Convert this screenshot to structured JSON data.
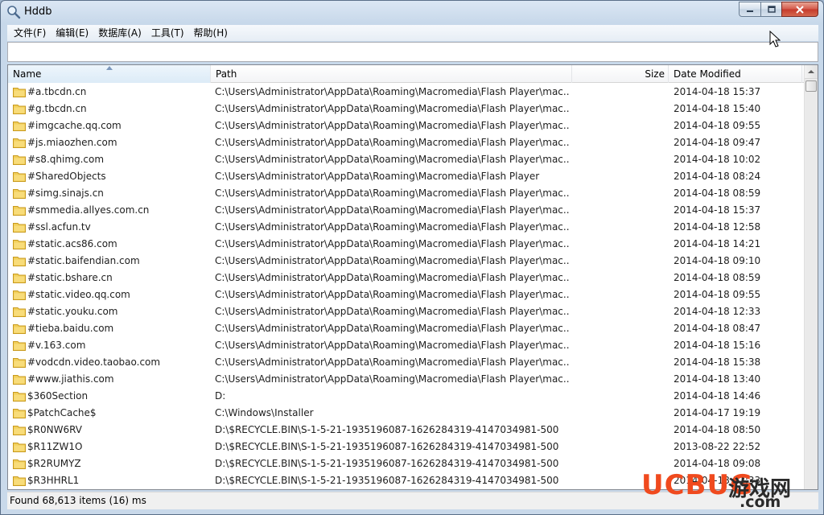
{
  "window": {
    "title": "Hddb"
  },
  "menu": [
    "文件(F)",
    "编辑(E)",
    "数据库(A)",
    "工具(T)",
    "帮助(H)"
  ],
  "search": {
    "value": "",
    "placeholder": ""
  },
  "columns": {
    "name": "Name",
    "path": "Path",
    "size": "Size",
    "date": "Date Modified"
  },
  "rows": [
    {
      "name": "#a.tbcdn.cn",
      "path": "C:\\Users\\Administrator\\AppData\\Roaming\\Macromedia\\Flash Player\\mac...",
      "size": "",
      "date": "2014-04-18 15:37"
    },
    {
      "name": "#g.tbcdn.cn",
      "path": "C:\\Users\\Administrator\\AppData\\Roaming\\Macromedia\\Flash Player\\mac...",
      "size": "",
      "date": "2014-04-18 15:40"
    },
    {
      "name": "#imgcache.qq.com",
      "path": "C:\\Users\\Administrator\\AppData\\Roaming\\Macromedia\\Flash Player\\mac...",
      "size": "",
      "date": "2014-04-18 09:55"
    },
    {
      "name": "#js.miaozhen.com",
      "path": "C:\\Users\\Administrator\\AppData\\Roaming\\Macromedia\\Flash Player\\mac...",
      "size": "",
      "date": "2014-04-18 09:47"
    },
    {
      "name": "#s8.qhimg.com",
      "path": "C:\\Users\\Administrator\\AppData\\Roaming\\Macromedia\\Flash Player\\mac...",
      "size": "",
      "date": "2014-04-18 10:02"
    },
    {
      "name": "#SharedObjects",
      "path": "C:\\Users\\Administrator\\AppData\\Roaming\\Macromedia\\Flash Player",
      "size": "",
      "date": "2014-04-18 08:24"
    },
    {
      "name": "#simg.sinajs.cn",
      "path": "C:\\Users\\Administrator\\AppData\\Roaming\\Macromedia\\Flash Player\\mac...",
      "size": "",
      "date": "2014-04-18 08:59"
    },
    {
      "name": "#smmedia.allyes.com.cn",
      "path": "C:\\Users\\Administrator\\AppData\\Roaming\\Macromedia\\Flash Player\\mac...",
      "size": "",
      "date": "2014-04-18 15:37"
    },
    {
      "name": "#ssl.acfun.tv",
      "path": "C:\\Users\\Administrator\\AppData\\Roaming\\Macromedia\\Flash Player\\mac...",
      "size": "",
      "date": "2014-04-18 12:58"
    },
    {
      "name": "#static.acs86.com",
      "path": "C:\\Users\\Administrator\\AppData\\Roaming\\Macromedia\\Flash Player\\mac...",
      "size": "",
      "date": "2014-04-18 14:21"
    },
    {
      "name": "#static.baifendian.com",
      "path": "C:\\Users\\Administrator\\AppData\\Roaming\\Macromedia\\Flash Player\\mac...",
      "size": "",
      "date": "2014-04-18 09:10"
    },
    {
      "name": "#static.bshare.cn",
      "path": "C:\\Users\\Administrator\\AppData\\Roaming\\Macromedia\\Flash Player\\mac...",
      "size": "",
      "date": "2014-04-18 08:59"
    },
    {
      "name": "#static.video.qq.com",
      "path": "C:\\Users\\Administrator\\AppData\\Roaming\\Macromedia\\Flash Player\\mac...",
      "size": "",
      "date": "2014-04-18 09:55"
    },
    {
      "name": "#static.youku.com",
      "path": "C:\\Users\\Administrator\\AppData\\Roaming\\Macromedia\\Flash Player\\mac...",
      "size": "",
      "date": "2014-04-18 12:33"
    },
    {
      "name": "#tieba.baidu.com",
      "path": "C:\\Users\\Administrator\\AppData\\Roaming\\Macromedia\\Flash Player\\mac...",
      "size": "",
      "date": "2014-04-18 08:47"
    },
    {
      "name": "#v.163.com",
      "path": "C:\\Users\\Administrator\\AppData\\Roaming\\Macromedia\\Flash Player\\mac...",
      "size": "",
      "date": "2014-04-18 15:16"
    },
    {
      "name": "#vodcdn.video.taobao.com",
      "path": "C:\\Users\\Administrator\\AppData\\Roaming\\Macromedia\\Flash Player\\mac...",
      "size": "",
      "date": "2014-04-18 15:38"
    },
    {
      "name": "#www.jiathis.com",
      "path": "C:\\Users\\Administrator\\AppData\\Roaming\\Macromedia\\Flash Player\\mac...",
      "size": "",
      "date": "2014-04-18 13:40"
    },
    {
      "name": "$360Section",
      "path": "D:",
      "size": "",
      "date": "2014-04-18 14:46"
    },
    {
      "name": "$PatchCache$",
      "path": "C:\\Windows\\Installer",
      "size": "",
      "date": "2014-04-17 19:19"
    },
    {
      "name": "$R0NW6RV",
      "path": "D:\\$RECYCLE.BIN\\S-1-5-21-1935196087-1626284319-4147034981-500",
      "size": "",
      "date": "2014-04-18 08:50"
    },
    {
      "name": "$R11ZW1O",
      "path": "D:\\$RECYCLE.BIN\\S-1-5-21-1935196087-1626284319-4147034981-500",
      "size": "",
      "date": "2013-08-22 22:52"
    },
    {
      "name": "$R2RUMYZ",
      "path": "D:\\$RECYCLE.BIN\\S-1-5-21-1935196087-1626284319-4147034981-500",
      "size": "",
      "date": "2014-04-18 09:08"
    },
    {
      "name": "$R3HHRL1",
      "path": "D:\\$RECYCLE.BIN\\S-1-5-21-1935196087-1626284319-4147034981-500",
      "size": "",
      "date": "2014-04-18 11:33"
    }
  ],
  "status": {
    "text": "Found 68,613 items (16) ms"
  },
  "watermark": {
    "brand": "UCBUG",
    "subtitle": "游戏网",
    "domain": ".com"
  },
  "colors": {
    "folder": "#e8b730",
    "accent": "#f04a1e"
  },
  "icons": {
    "app": "magnifier-icon",
    "folder": "folder-icon"
  }
}
